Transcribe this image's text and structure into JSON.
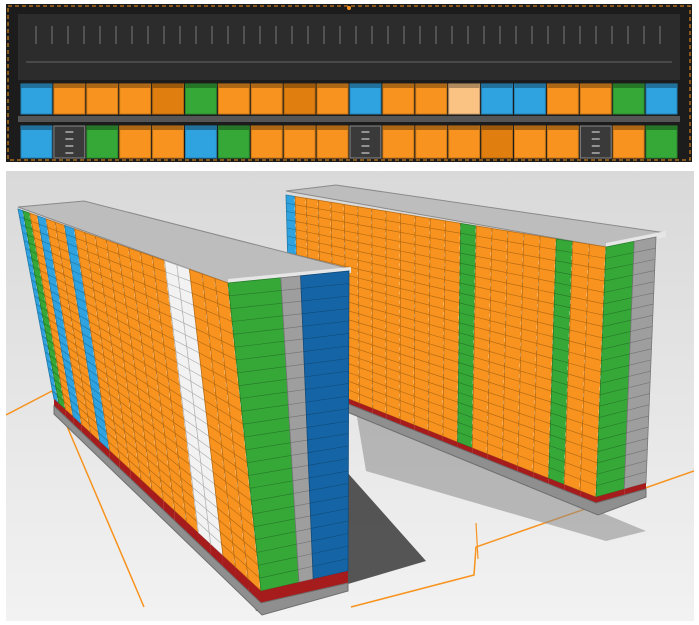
{
  "colors": {
    "orange": "#f7931e",
    "dark_orange": "#e07f0f",
    "light_orange": "#fbc383",
    "blue": "#2ea3e0",
    "dark_blue": "#1565a6",
    "green": "#35a838",
    "dark_green": "#2a8a2c",
    "white": "#f2f2f2",
    "gray": "#9e9e9e",
    "dark_gray": "#2e2e2e",
    "red": "#a61b1b",
    "guide_line": "#f7931e"
  },
  "plan": {
    "top_row": [
      "blue",
      "orange",
      "orange",
      "orange",
      "dark_orange",
      "green",
      "orange",
      "orange",
      "dark_orange",
      "orange",
      "blue",
      "orange",
      "orange",
      "light_orange",
      "blue",
      "blue",
      "orange",
      "orange",
      "green",
      "blue"
    ],
    "bottom_row": [
      "blue",
      "door",
      "green",
      "orange",
      "orange",
      "blue",
      "green",
      "orange",
      "orange",
      "orange",
      "door",
      "orange",
      "orange",
      "orange",
      "dark_orange",
      "orange",
      "orange",
      "door",
      "orange",
      "green"
    ]
  },
  "rack_left": {
    "face_columns": [
      "blue",
      "green",
      "orange",
      "blue",
      "orange",
      "orange",
      "blue",
      "orange",
      "orange",
      "orange",
      "orange",
      "orange",
      "orange",
      "orange",
      "orange",
      "white",
      "white",
      "orange",
      "orange",
      "orange"
    ],
    "end_columns": [
      "green",
      "gray",
      "dark_blue"
    ]
  },
  "rack_right": {
    "face_columns": [
      "blue",
      "orange",
      "orange",
      "orange",
      "orange",
      "orange",
      "orange",
      "orange",
      "orange",
      "orange",
      "orange",
      "orange",
      "orange",
      "green",
      "orange",
      "orange",
      "orange",
      "orange",
      "orange",
      "green",
      "orange",
      "orange"
    ],
    "end_columns": [
      "green",
      "gray"
    ]
  }
}
